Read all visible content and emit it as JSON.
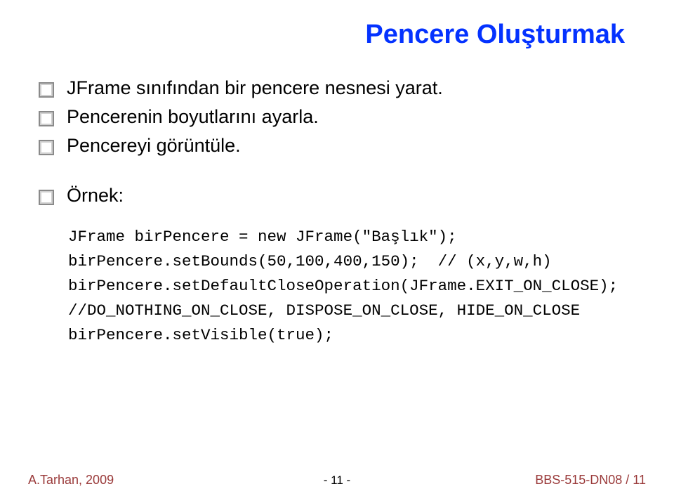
{
  "title": "Pencere Oluşturmak",
  "bullets": [
    "JFrame sınıfından bir pencere nesnesi yarat.",
    "Pencerenin boyutlarını ayarla.",
    "Pencereyi görüntüle.",
    "Örnek:"
  ],
  "code": {
    "line1": "JFrame birPencere = new JFrame(\"Başlık\");",
    "line2": "birPencere.setBounds(50,100,400,150);  // (x,y,w,h)",
    "line3": "birPencere.setDefaultCloseOperation(JFrame.EXIT_ON_CLOSE);",
    "line4": "//DO_NOTHING_ON_CLOSE, DISPOSE_ON_CLOSE, HIDE_ON_CLOSE",
    "line5": "birPencere.setVisible(true);"
  },
  "footer": {
    "left": "A.Tarhan, 2009",
    "center": "- 11 -",
    "right": "BBS-515-DN08 / 11"
  }
}
